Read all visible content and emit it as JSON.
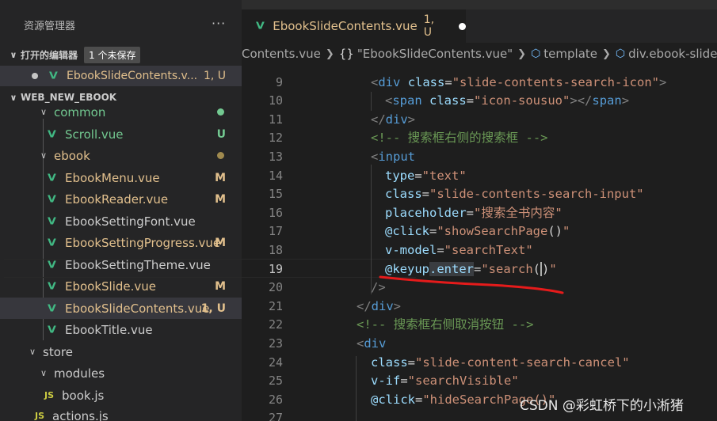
{
  "explorer": {
    "title": "资源管理器",
    "more_icon": "···",
    "open_editors": {
      "label": "打开的编辑器",
      "badge": "1 个未保存"
    },
    "open_file": {
      "name": "EbookSlideContents.v...",
      "status": "1, U"
    },
    "project": {
      "name": "WEB_NEW_EBOOK"
    },
    "tree": [
      {
        "name": "common",
        "status": "",
        "kind": "folder"
      },
      {
        "name": "Scroll.vue",
        "status": "U",
        "kind": "vue"
      },
      {
        "name": "ebook",
        "status": "",
        "kind": "folder"
      },
      {
        "name": "EbookMenu.vue",
        "status": "M",
        "kind": "vue"
      },
      {
        "name": "EbookReader.vue",
        "status": "M",
        "kind": "vue"
      },
      {
        "name": "EbookSettingFont.vue",
        "status": "",
        "kind": "vue"
      },
      {
        "name": "EbookSettingProgress.vue",
        "status": "M",
        "kind": "vue"
      },
      {
        "name": "EbookSettingTheme.vue",
        "status": "",
        "kind": "vue"
      },
      {
        "name": "EbookSlide.vue",
        "status": "M",
        "kind": "vue"
      },
      {
        "name": "EbookSlideContents.vue",
        "status": "1, U",
        "kind": "vue"
      },
      {
        "name": "EbookTitle.vue",
        "status": "",
        "kind": "vue"
      },
      {
        "name": "store",
        "status": "",
        "kind": "folder"
      },
      {
        "name": "modules",
        "status": "",
        "kind": "folder"
      },
      {
        "name": "book.js",
        "status": "",
        "kind": "js"
      },
      {
        "name": "actions.js",
        "status": "",
        "kind": "js"
      }
    ]
  },
  "tab": {
    "label": "EbookSlideContents.vue",
    "status": "1, U"
  },
  "breadcrumb": {
    "file": "Contents.vue",
    "component": "\"EbookSlideContents.vue\"",
    "template": "template",
    "node": "div.ebook-slide-co"
  },
  "code": {
    "line_numbers": [
      "9",
      "10",
      "11",
      "12",
      "13",
      "14",
      "15",
      "16",
      "17",
      "18",
      "19",
      "20",
      "21",
      "22",
      "23",
      "24",
      "25",
      "26",
      "27"
    ],
    "l9": {
      "tag": "div",
      "attr": "class",
      "val": "\"slide-contents-search-icon\""
    },
    "l10": {
      "tag": "span",
      "attr": "class",
      "val": "\"icon-sousuo\"",
      "close": "span"
    },
    "l11": {
      "close": "div"
    },
    "l12": {
      "comment": "<!-- 搜索框右侧的搜索框 -->"
    },
    "l13": {
      "tag": "input"
    },
    "l14": {
      "attr": "type",
      "val": "\"text\""
    },
    "l15": {
      "attr": "class",
      "val": "\"slide-contents-search-input\""
    },
    "l16": {
      "attr": "placeholder",
      "val": "\"搜索全书内容\""
    },
    "l17": {
      "attr": "@click",
      "val_a": "\"showSearchPage",
      "val_b": "()",
      "val_c": "\""
    },
    "l18": {
      "attr": "v-model",
      "val": "\"searchText\""
    },
    "l19": {
      "attr_a": "@keyup",
      "attr_b": ".enter",
      "val_a": "\"search",
      "val_b": "(",
      "val_c": ")",
      "val_d": "\""
    },
    "l20": {
      "selfclose": "/>"
    },
    "l21": {
      "close": "div"
    },
    "l22": {
      "comment": "<!-- 搜索框右侧取消按钮 -->"
    },
    "l23": {
      "tag": "div"
    },
    "l24": {
      "attr": "class",
      "val": "\"slide-content-search-cancel\""
    },
    "l25": {
      "attr": "v-if",
      "val": "\"searchVisible\""
    },
    "l26": {
      "attr": "@click",
      "val": "\"hideSearchPage()\""
    }
  },
  "watermark": "CSDN @彩虹桥下的小淅猪"
}
